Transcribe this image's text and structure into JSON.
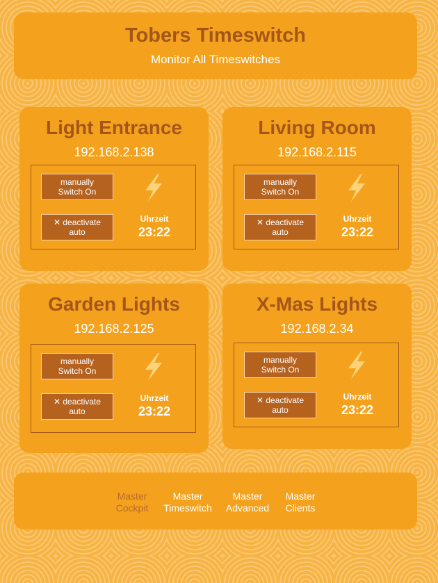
{
  "header": {
    "title": "Tobers Timeswitch",
    "subtitle": "Monitor All Timeswitches"
  },
  "cards": [
    {
      "name": "Light Entrance",
      "ip": "192.168.2.138",
      "switch_on_line1": "manually",
      "switch_on_line2": "Switch On",
      "deactivate_line1": "✕ deactivate",
      "deactivate_line2": "auto",
      "time_label": "Uhrzeit",
      "time": "23:22"
    },
    {
      "name": "Living Room",
      "ip": "192.168.2.115",
      "switch_on_line1": "manually",
      "switch_on_line2": "Switch On",
      "deactivate_line1": "✕ deactivate",
      "deactivate_line2": "auto",
      "time_label": "Uhrzeit",
      "time": "23:22"
    },
    {
      "name": "Garden Lights",
      "ip": "192.168.2.125",
      "switch_on_line1": "manually",
      "switch_on_line2": "Switch On",
      "deactivate_line1": "✕ deactivate",
      "deactivate_line2": "auto",
      "time_label": "Uhrzeit",
      "time": "23:22"
    },
    {
      "name": "X-Mas Lights",
      "ip": "192.168.2.34",
      "switch_on_line1": "manually",
      "switch_on_line2": "Switch On",
      "deactivate_line1": "✕ deactivate",
      "deactivate_line2": "auto",
      "time_label": "Uhrzeit",
      "time": "23:22"
    }
  ],
  "footer": {
    "nav": [
      {
        "line1": "Master",
        "line2": "Cockpit"
      },
      {
        "line1": "Master",
        "line2": "Timeswitch"
      },
      {
        "line1": "Master",
        "line2": "Advanced"
      },
      {
        "line1": "Master",
        "line2": "Clients"
      }
    ]
  },
  "colors": {
    "background": "#f6b445",
    "panel": "#f4a21d",
    "title": "#a4561a",
    "button": "#b5621f",
    "nav_active": "#b86a2a"
  },
  "icons": {
    "power": "lightning-bolt-icon"
  }
}
